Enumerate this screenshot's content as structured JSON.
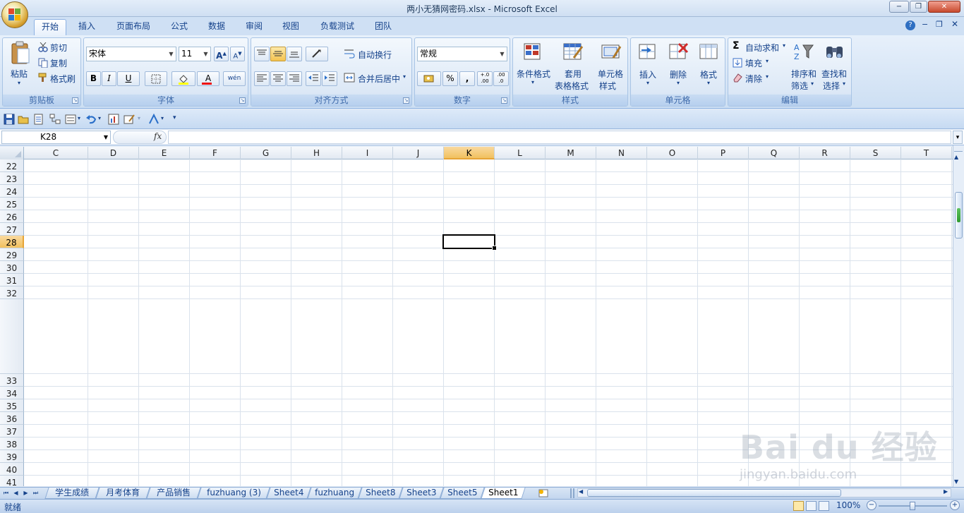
{
  "window": {
    "title": "两小无猜网密码.xlsx - Microsoft Excel",
    "minimize": "−",
    "restore": "❐",
    "close": "✕"
  },
  "tabs": [
    {
      "label": "开始",
      "active": true
    },
    {
      "label": "插入"
    },
    {
      "label": "页面布局"
    },
    {
      "label": "公式"
    },
    {
      "label": "数据"
    },
    {
      "label": "审阅"
    },
    {
      "label": "视图"
    },
    {
      "label": "负载测试"
    },
    {
      "label": "团队"
    }
  ],
  "ribbon": {
    "clipboard": {
      "label": "剪贴板",
      "paste": "粘贴",
      "cut": "剪切",
      "copy": "复制",
      "format_painter": "格式刷"
    },
    "font": {
      "label": "字体",
      "name": "宋体",
      "size": "11",
      "bold": "B",
      "italic": "I",
      "underline": "U",
      "grow": "A",
      "shrink": "A",
      "font_color": "A",
      "phonetic": "wén"
    },
    "alignment": {
      "label": "对齐方式",
      "wrap": "自动换行",
      "merge": "合并后居中"
    },
    "number": {
      "label": "数字",
      "format": "常规",
      "percent": "%",
      "comma": ",",
      "inc_decimal": "+.0 .00",
      "dec_decimal": ".00 .0"
    },
    "styles": {
      "label": "样式",
      "conditional": "条件格式",
      "table_line1": "套用",
      "table_line2": "表格格式",
      "cell_styles_line1": "单元格",
      "cell_styles_line2": "样式"
    },
    "cells": {
      "label": "单元格",
      "insert": "插入",
      "delete": "删除",
      "format": "格式"
    },
    "editing": {
      "label": "编辑",
      "autosum": "自动求和",
      "fill": "填充",
      "clear": "清除",
      "sort_line1": "排序和",
      "sort_line2": "筛选",
      "find_line1": "查找和",
      "find_line2": "选择"
    }
  },
  "formula_bar": {
    "name_box": "K28",
    "fx": "fx",
    "formula": ""
  },
  "grid": {
    "columns": [
      "C",
      "D",
      "E",
      "F",
      "G",
      "H",
      "I",
      "J",
      "K",
      "L",
      "M",
      "N",
      "O",
      "P",
      "Q",
      "R",
      "S",
      "T"
    ],
    "selected_column": "K",
    "rows": [
      "22",
      "23",
      "24",
      "25",
      "26",
      "27",
      "28",
      "29",
      "30",
      "31",
      "32",
      "33",
      "34",
      "35",
      "36",
      "37",
      "38",
      "39",
      "40",
      "41"
    ],
    "selected_row": "28"
  },
  "sheets": [
    {
      "label": "学生成绩"
    },
    {
      "label": "月考体育"
    },
    {
      "label": "产品销售"
    },
    {
      "label": "fuzhuang (3)"
    },
    {
      "label": "Sheet4"
    },
    {
      "label": "fuzhuang"
    },
    {
      "label": "Sheet8"
    },
    {
      "label": "Sheet3"
    },
    {
      "label": "Sheet5"
    },
    {
      "label": "Sheet1",
      "active": true
    }
  ],
  "status": {
    "text": "就绪",
    "zoom": "100%"
  },
  "watermark": {
    "brand": "Bai du 经验",
    "url": "jingyan.baidu.com"
  }
}
